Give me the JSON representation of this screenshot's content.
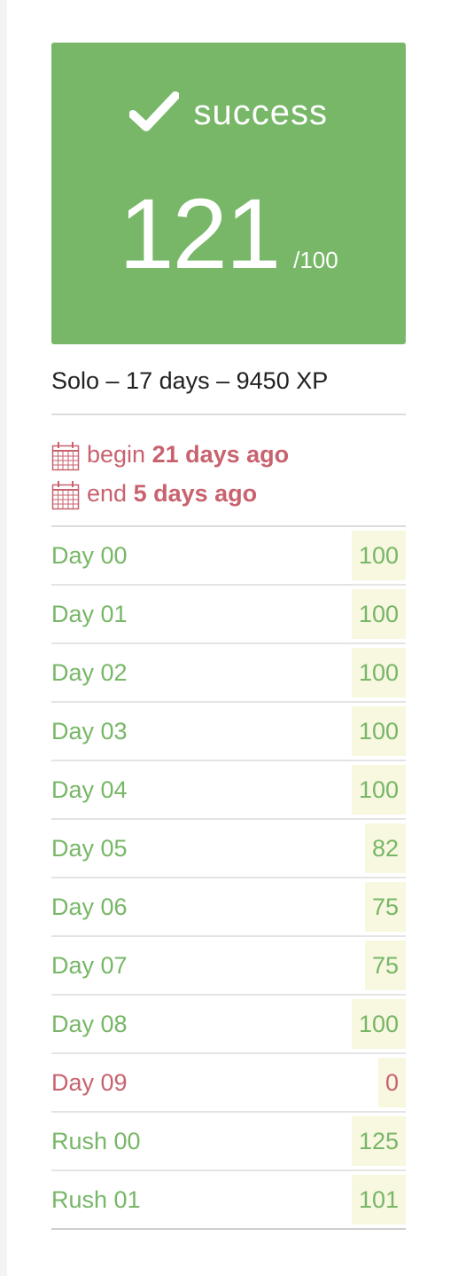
{
  "result": {
    "status": "success",
    "score": "121",
    "max_score": "/100"
  },
  "summary": "Solo – 17 days – 9450 XP",
  "dates": {
    "begin_prefix": "begin",
    "begin_value": "21 days ago",
    "end_prefix": "end",
    "end_value": "5 days ago"
  },
  "colors": {
    "success": "#77b767",
    "failure": "#c8626e",
    "score_background": "#f8f7e0"
  },
  "rows": [
    {
      "label": "Day 00",
      "score": "100",
      "state": "ok"
    },
    {
      "label": "Day 01",
      "score": "100",
      "state": "ok"
    },
    {
      "label": "Day 02",
      "score": "100",
      "state": "ok"
    },
    {
      "label": "Day 03",
      "score": "100",
      "state": "ok"
    },
    {
      "label": "Day 04",
      "score": "100",
      "state": "ok"
    },
    {
      "label": "Day 05",
      "score": "82",
      "state": "ok"
    },
    {
      "label": "Day 06",
      "score": "75",
      "state": "ok"
    },
    {
      "label": "Day 07",
      "score": "75",
      "state": "ok"
    },
    {
      "label": "Day 08",
      "score": "100",
      "state": "ok"
    },
    {
      "label": "Day 09",
      "score": "0",
      "state": "fail"
    },
    {
      "label": "Rush 00",
      "score": "125",
      "state": "ok"
    },
    {
      "label": "Rush 01",
      "score": "101",
      "state": "ok"
    }
  ]
}
